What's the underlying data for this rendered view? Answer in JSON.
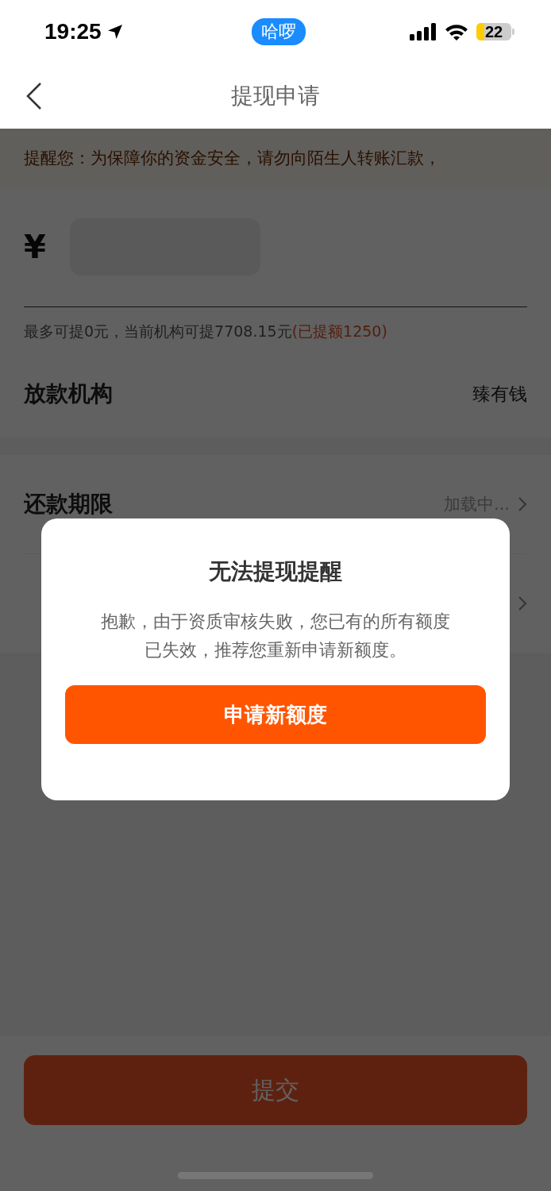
{
  "status_bar": {
    "time": "19:25",
    "pill": "哈啰",
    "battery": "22"
  },
  "nav": {
    "title": "提现申请"
  },
  "notice": "提醒您：为保障你的资金安全，请勿向陌生人转账汇款，",
  "amount": {
    "currency": "¥"
  },
  "hint": {
    "text": "最多可提0元，当前机构可提7708.15元",
    "highlight": "(已提额1250)"
  },
  "sections": [
    {
      "rows": [
        {
          "label": "放款机构",
          "value": "臻有钱",
          "kind": "value",
          "chevron": false
        }
      ]
    },
    {
      "rows": [
        {
          "label": "还款期限",
          "value": "加载中...",
          "kind": "loading",
          "chevron": true
        },
        {
          "chevron": true
        }
      ]
    }
  ],
  "dialog": {
    "title": "无法提现提醒",
    "message": "抱歉，由于资质审核失败，您已有的所有额度已失效，推荐您重新申请新额度。",
    "button": "申请新额度"
  },
  "submit": {
    "label": "提交"
  }
}
